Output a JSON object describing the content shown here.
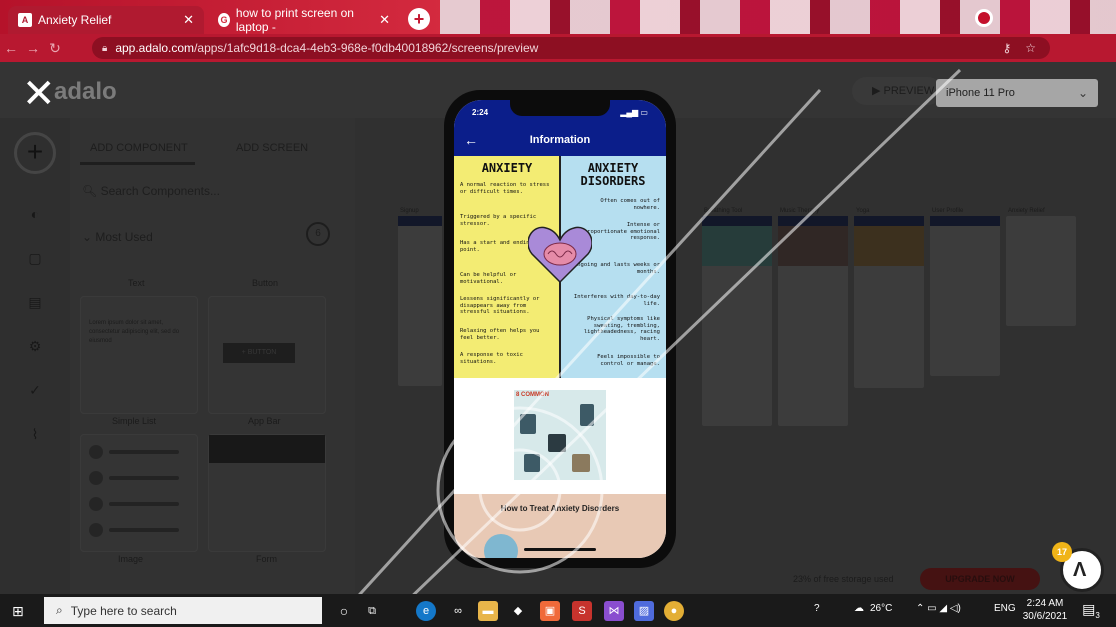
{
  "browser": {
    "tabs": [
      {
        "label": "Anxiety Relief",
        "favicon": "adalo-icon",
        "active": true
      },
      {
        "label": "how to print screen on laptop -",
        "favicon": "google-icon",
        "active": false
      }
    ],
    "new_tab": "+",
    "url_host": "app.adalo.com",
    "url_path": "/apps/1afc9d18-dca4-4eb3-968e-f0db40018962/screens/preview"
  },
  "app": {
    "logo": "adalo",
    "close": "✕",
    "preview_label": "PREVIEW",
    "device_select": "iPhone 11 Pro",
    "panel": {
      "tabs": [
        "ADD COMPONENT",
        "ADD SCREEN"
      ],
      "search_placeholder": "Search Components...",
      "section": "Most Used",
      "section_count": "6",
      "components": [
        "Text",
        "Button",
        "Simple List",
        "App Bar",
        "Image",
        "Form"
      ],
      "lorem": "Lorem ipsum dolor sit amet, consectetur adipiscing elit, sed do eiusmod",
      "button_text": "+ BUTTON"
    },
    "screens": [
      "Signup",
      "Breathing Tool",
      "Music Therapy",
      "Yoga",
      "User Profile",
      "Anxiety Relief"
    ],
    "storage_text": "23% of free storage used",
    "upgrade_label": "UPGRADE NOW",
    "help_count": "17"
  },
  "phone": {
    "time": "2:24",
    "title": "Information",
    "left_heading": "ANXIETY",
    "right_heading": "ANXIETY DISORDERS",
    "left_items": [
      "A normal reaction to stress or difficult times.",
      "Triggered by a specific stressor.",
      "Has a start and ending point.",
      "Can be helpful or motivational.",
      "Lessens significantly or disappears away from stressful situations.",
      "Relaxing often helps you feel better.",
      "A response to toxic situations."
    ],
    "right_items": [
      "Often comes out of nowhere.",
      "Intense or disproportionate emotional response.",
      "Ongoing and lasts weeks or months.",
      "Interferes with day-to-day life.",
      "Physical symptoms like sweating, trembling, lightheadedness, racing heart.",
      "Feels impossible to control or manage."
    ],
    "doc_badge": "8 COMMON",
    "treat_title": "How to Treat Anxiety Disorders"
  },
  "taskbar": {
    "search": "Type here to search",
    "weather": "26°C",
    "lang": "ENG",
    "time": "2:24 AM",
    "date": "30/6/2021",
    "notif_count": "3"
  },
  "colors": {
    "accent_red": "#c41a33",
    "app_bar_blue": "#0b1e8a",
    "infographic_yellow": "#f3ec73",
    "infographic_blue": "#b6dff0"
  }
}
